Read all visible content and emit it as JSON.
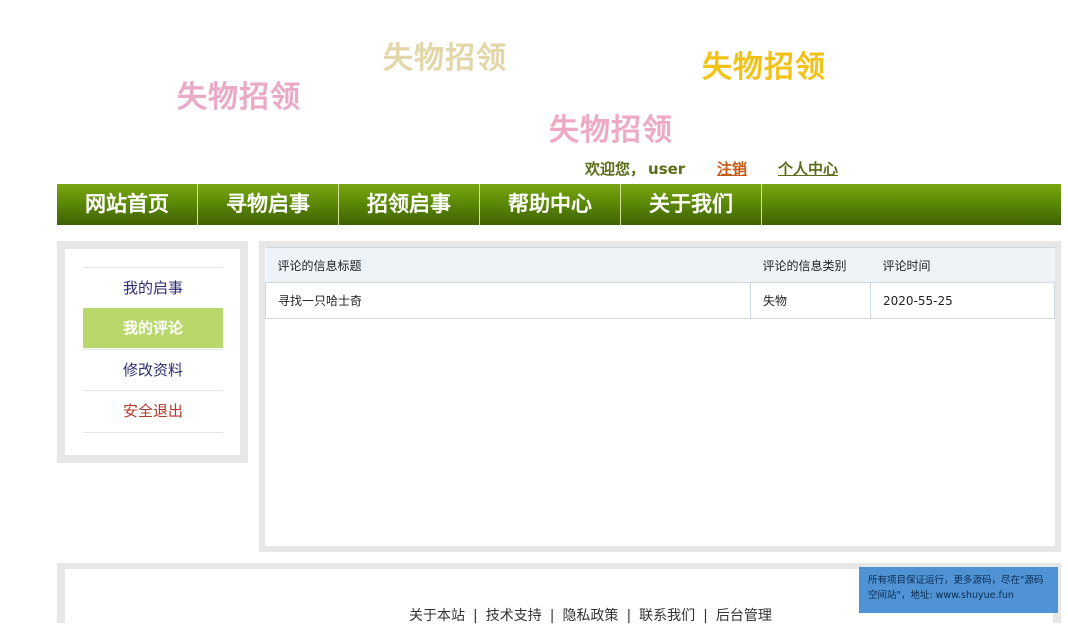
{
  "banner": {
    "floaters": [
      {
        "text": "失物招领",
        "color": "#e9a9c7"
      },
      {
        "text": "失物招领",
        "color": "#e3d7a9"
      },
      {
        "text": "失物招领",
        "color": "#f1c319"
      },
      {
        "text": "失物招领",
        "color": "#eeaac3"
      }
    ]
  },
  "header": {
    "welcome_prefix": "欢迎您，",
    "username": "user",
    "logout_label": "注销",
    "profile_label": "个人中心"
  },
  "nav": {
    "items": [
      "网站首页",
      "寻物启事",
      "招领启事",
      "帮助中心",
      "关于我们"
    ]
  },
  "sidebar": {
    "items": [
      {
        "label": "我的启事",
        "color": "#2d2d73"
      },
      {
        "label": "我的评论",
        "active": true
      },
      {
        "label": "修改资料",
        "color": "#2d2d73"
      },
      {
        "label": "安全退出",
        "color": "#b03a2e"
      }
    ]
  },
  "table": {
    "headers": [
      "评论的信息标题",
      "评论的信息类别",
      "评论时间"
    ],
    "rows": [
      [
        "寻找一只哈士奇",
        "失物",
        "2020-55-25"
      ]
    ]
  },
  "footer": {
    "links": [
      "关于本站",
      "技术支持",
      "隐私政策",
      "联系我们",
      "后台管理"
    ],
    "separator": "|"
  },
  "notice": {
    "text": "所有项目保证运行，更多源码，尽在\"源码空间站\"，地址: www.shuyue.fun"
  },
  "colors": {
    "nav_green": "#5c8a06",
    "sidebar_active": "#b9d86c"
  }
}
